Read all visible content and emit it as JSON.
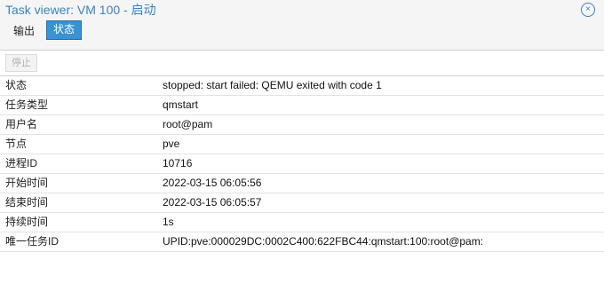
{
  "window": {
    "title": "Task viewer: VM 100 - 启动",
    "close_glyph": "×"
  },
  "tabs": [
    {
      "label": "输出",
      "active": false
    },
    {
      "label": "状态",
      "active": true
    }
  ],
  "toolbar": {
    "stop_label": "停止"
  },
  "status": {
    "rows": [
      {
        "key": "状态",
        "value": "stopped: start failed: QEMU exited with code 1"
      },
      {
        "key": "任务类型",
        "value": "qmstart"
      },
      {
        "key": "用户名",
        "value": "root@pam"
      },
      {
        "key": "节点",
        "value": "pve"
      },
      {
        "key": "进程ID",
        "value": "10716"
      },
      {
        "key": "开始时间",
        "value": "2022-03-15 06:05:56"
      },
      {
        "key": "结束时间",
        "value": "2022-03-15 06:05:57"
      },
      {
        "key": "持续时间",
        "value": "1s"
      },
      {
        "key": "唯一任务ID",
        "value": "UPID:pve:000029DC:0002C400:622FBC44:qmstart:100:root@pam:"
      }
    ]
  },
  "colors": {
    "accent": "#3892d4",
    "title": "#3b82c4"
  }
}
